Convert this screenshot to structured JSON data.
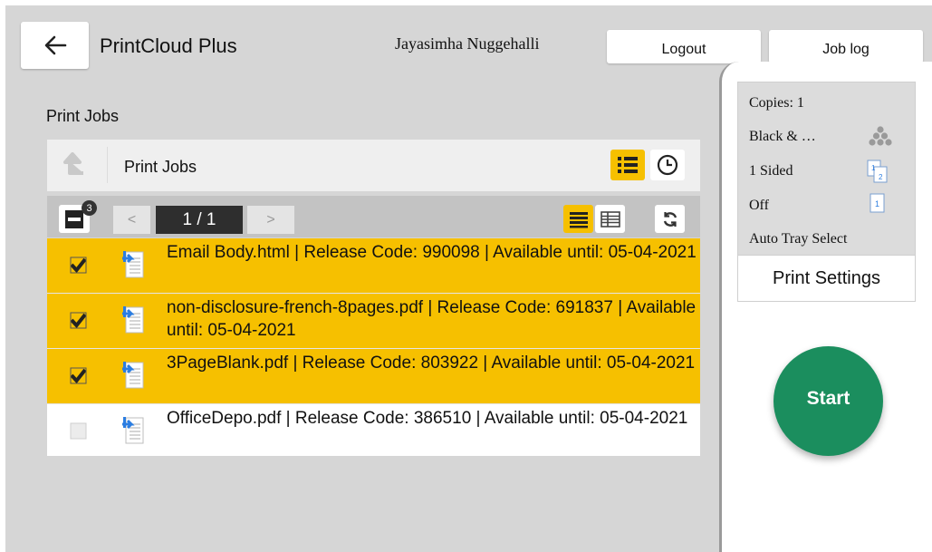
{
  "header": {
    "app_title": "PrintCloud Plus",
    "user_name": "Jayasimha Nuggehalli",
    "logout_label": "Logout",
    "job_log_label": "Job log"
  },
  "section_title": "Print Jobs",
  "toolbar": {
    "title": "Print Jobs"
  },
  "pager": {
    "selected_count": "3",
    "prev_label": "<",
    "page": "1 / 1",
    "next_label": ">"
  },
  "jobs": [
    {
      "text": "Email Body.html | Release Code: 990098 | Available until: 05-04-2021",
      "selected": true
    },
    {
      "text": "non-disclosure-french-8pages.pdf | Release Code: 691837 | Available until: 05-04-2021",
      "selected": true
    },
    {
      "text": "3PageBlank.pdf | Release Code: 803922 | Available until: 05-04-2021",
      "selected": true
    },
    {
      "text": "OfficeDepo.pdf | Release Code: 386510 | Available until: 05-04-2021",
      "selected": false
    }
  ],
  "settings": {
    "copies": "Copies: 1",
    "color": "Black & …",
    "sides": "1 Sided",
    "nup": "Off",
    "tray": "Auto Tray Select",
    "print_settings_label": "Print Settings"
  },
  "start_label": "Start",
  "colors": {
    "accent_yellow": "#f6c000",
    "start_green": "#1b8e5e",
    "background_gray": "#d6d6d6",
    "page_indicator": "#2e2e2e"
  },
  "icons": {
    "back": "arrow-left-icon",
    "up": "arrow-up-icon",
    "list_view": "list-icon",
    "history": "clock-icon",
    "select_all": "minus-checkbox-icon",
    "detail_view": "detail-list-icon",
    "compact_view": "compact-list-icon",
    "refresh": "refresh-icon",
    "job_document": "document-download-icon",
    "color_mode": "color-dots-icon",
    "sides": "duplex-page-icon",
    "nup": "single-page-icon"
  }
}
